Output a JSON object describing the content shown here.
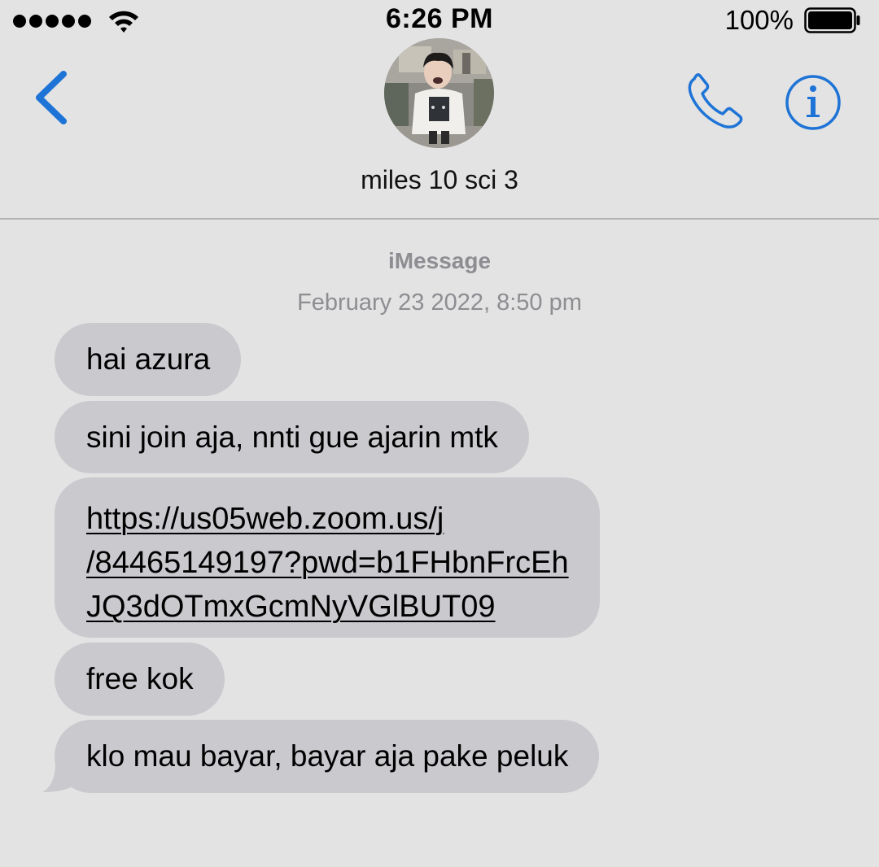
{
  "status_bar": {
    "time": "6:26 PM",
    "battery_percent": "100%",
    "signal_bars": 5,
    "wifi_icon": "wifi-icon",
    "battery_icon": "battery-full-icon"
  },
  "header": {
    "back_icon": "chevron-left-icon",
    "avatar_icon": "contact-photo",
    "contact_name": "miles 10 sci 3",
    "call_icon": "phone-icon",
    "info_icon": "info-icon",
    "accent_color": "#1e74d6"
  },
  "conversation": {
    "service": "iMessage",
    "timestamp": "February 23 2022, 8:50 pm",
    "messages": [
      {
        "text": "hai azura"
      },
      {
        "text": "sini join aja, nnti gue ajarin mtk"
      },
      {
        "lines": [
          "https://us05web.zoom.us/j",
          "/84465149197?pwd=b1FHbnFrcEh",
          "JQ3dOTmxGcmNyVGlBUT09"
        ]
      },
      {
        "text": "free kok"
      },
      {
        "text": "klo mau bayar, bayar aja pake peluk"
      }
    ],
    "bubble_color": "#c9c9ce"
  }
}
